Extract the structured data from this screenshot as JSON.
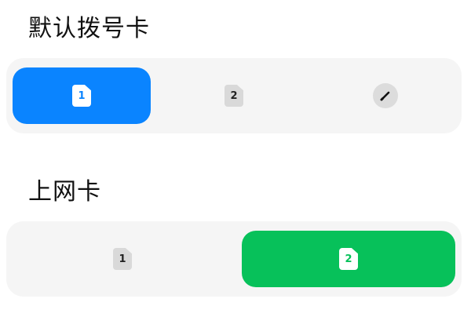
{
  "default_dial": {
    "title": "默认拨号卡",
    "options": [
      {
        "label": "1",
        "icon": "sim-card-icon",
        "selected": true
      },
      {
        "label": "2",
        "icon": "sim-card-icon",
        "selected": false
      },
      {
        "label": "",
        "icon": "pencil-icon",
        "selected": false
      }
    ]
  },
  "data_card": {
    "title": "上网卡",
    "options": [
      {
        "label": "1",
        "icon": "sim-card-icon",
        "selected": false
      },
      {
        "label": "2",
        "icon": "sim-card-icon",
        "selected": true
      }
    ]
  },
  "colors": {
    "dial_selected": "#0a84ff",
    "data_selected": "#07c15a",
    "group_background": "#f5f5f5",
    "icon_background": "#d9d9d9"
  }
}
